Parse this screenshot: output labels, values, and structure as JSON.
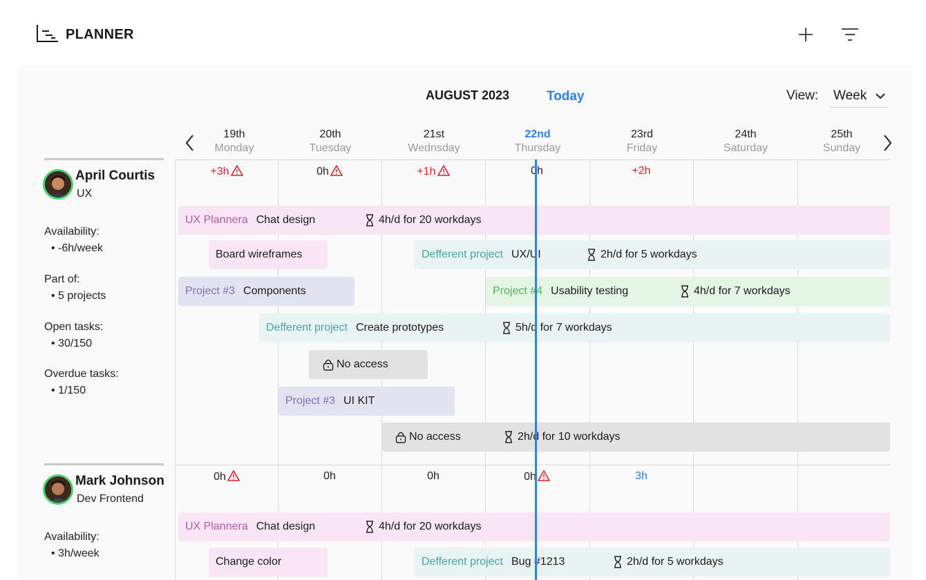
{
  "app": {
    "title": "PLANNER"
  },
  "header": {
    "month": "AUGUST 2023",
    "today": "Today",
    "view_label": "View:",
    "view_value": "Week"
  },
  "days": [
    {
      "date": "19th",
      "weekday": "Monday"
    },
    {
      "date": "20th",
      "weekday": "Tuesday"
    },
    {
      "date": "21st",
      "weekday": "Wednsday"
    },
    {
      "date": "22nd",
      "weekday": "Thursday"
    },
    {
      "date": "23rd",
      "weekday": "Friday"
    },
    {
      "date": "24th",
      "weekday": "Saturday"
    },
    {
      "date": "25th",
      "weekday": "Sunday"
    }
  ],
  "people": [
    {
      "name": "April Courtis",
      "role": "UX",
      "availability_label": "Availability:",
      "availability": "• -6h/week",
      "part_of_label": "Part of:",
      "part_of": "• 5 projects",
      "open_label": "Open tasks:",
      "open": "• 30/150",
      "overdue_label": "Overdue tasks:",
      "overdue": "• 1/150",
      "hours": [
        "+3h",
        "0h",
        "+1h",
        "0h",
        "+2h"
      ],
      "bars": [
        {
          "project": "UX Plannera",
          "task": "Chat design",
          "alloc": "4h/d for 20 workdays"
        },
        {
          "project": "",
          "task": "Board wireframes",
          "alloc": ""
        },
        {
          "project": "Defferent project",
          "task": "UX/UI",
          "alloc": "2h/d for 5 workdays"
        },
        {
          "project": "Project #3",
          "task": "Components",
          "alloc": ""
        },
        {
          "project": "Project #4",
          "task": "Usability testing",
          "alloc": "4h/d for 7 workdays"
        },
        {
          "project": "Defferent project",
          "task": "Create prototypes",
          "alloc": "5h/d for 7 workdays"
        },
        {
          "project": "",
          "task": "No access",
          "alloc": ""
        },
        {
          "project": "Project #3",
          "task": "UI KIT",
          "alloc": ""
        },
        {
          "project": "",
          "task": "No access",
          "alloc": "2h/d for 10 workdays"
        }
      ]
    },
    {
      "name": "Mark Johnson",
      "role": "Dev Frontend",
      "availability_label": "Availability:",
      "availability": "• 3h/week",
      "hours": [
        "0h",
        "0h",
        "0h",
        "0h",
        "3h"
      ],
      "bars": [
        {
          "project": "UX Plannera",
          "task": "Chat design",
          "alloc": "4h/d for 20 workdays"
        },
        {
          "project": "",
          "task": "Change color",
          "alloc": ""
        },
        {
          "project": "Defferent project",
          "task": "Bug  #1213",
          "alloc": "2h/d for 5 workdays"
        }
      ]
    }
  ],
  "colors": {
    "accent": "#2f80e6",
    "warning": "#d9222a",
    "pink": "#f8e6f6",
    "teal": "#e8f3f3",
    "violet": "#e3e2f0",
    "green": "#e5f5e3",
    "grey": "#e2e2e2"
  }
}
